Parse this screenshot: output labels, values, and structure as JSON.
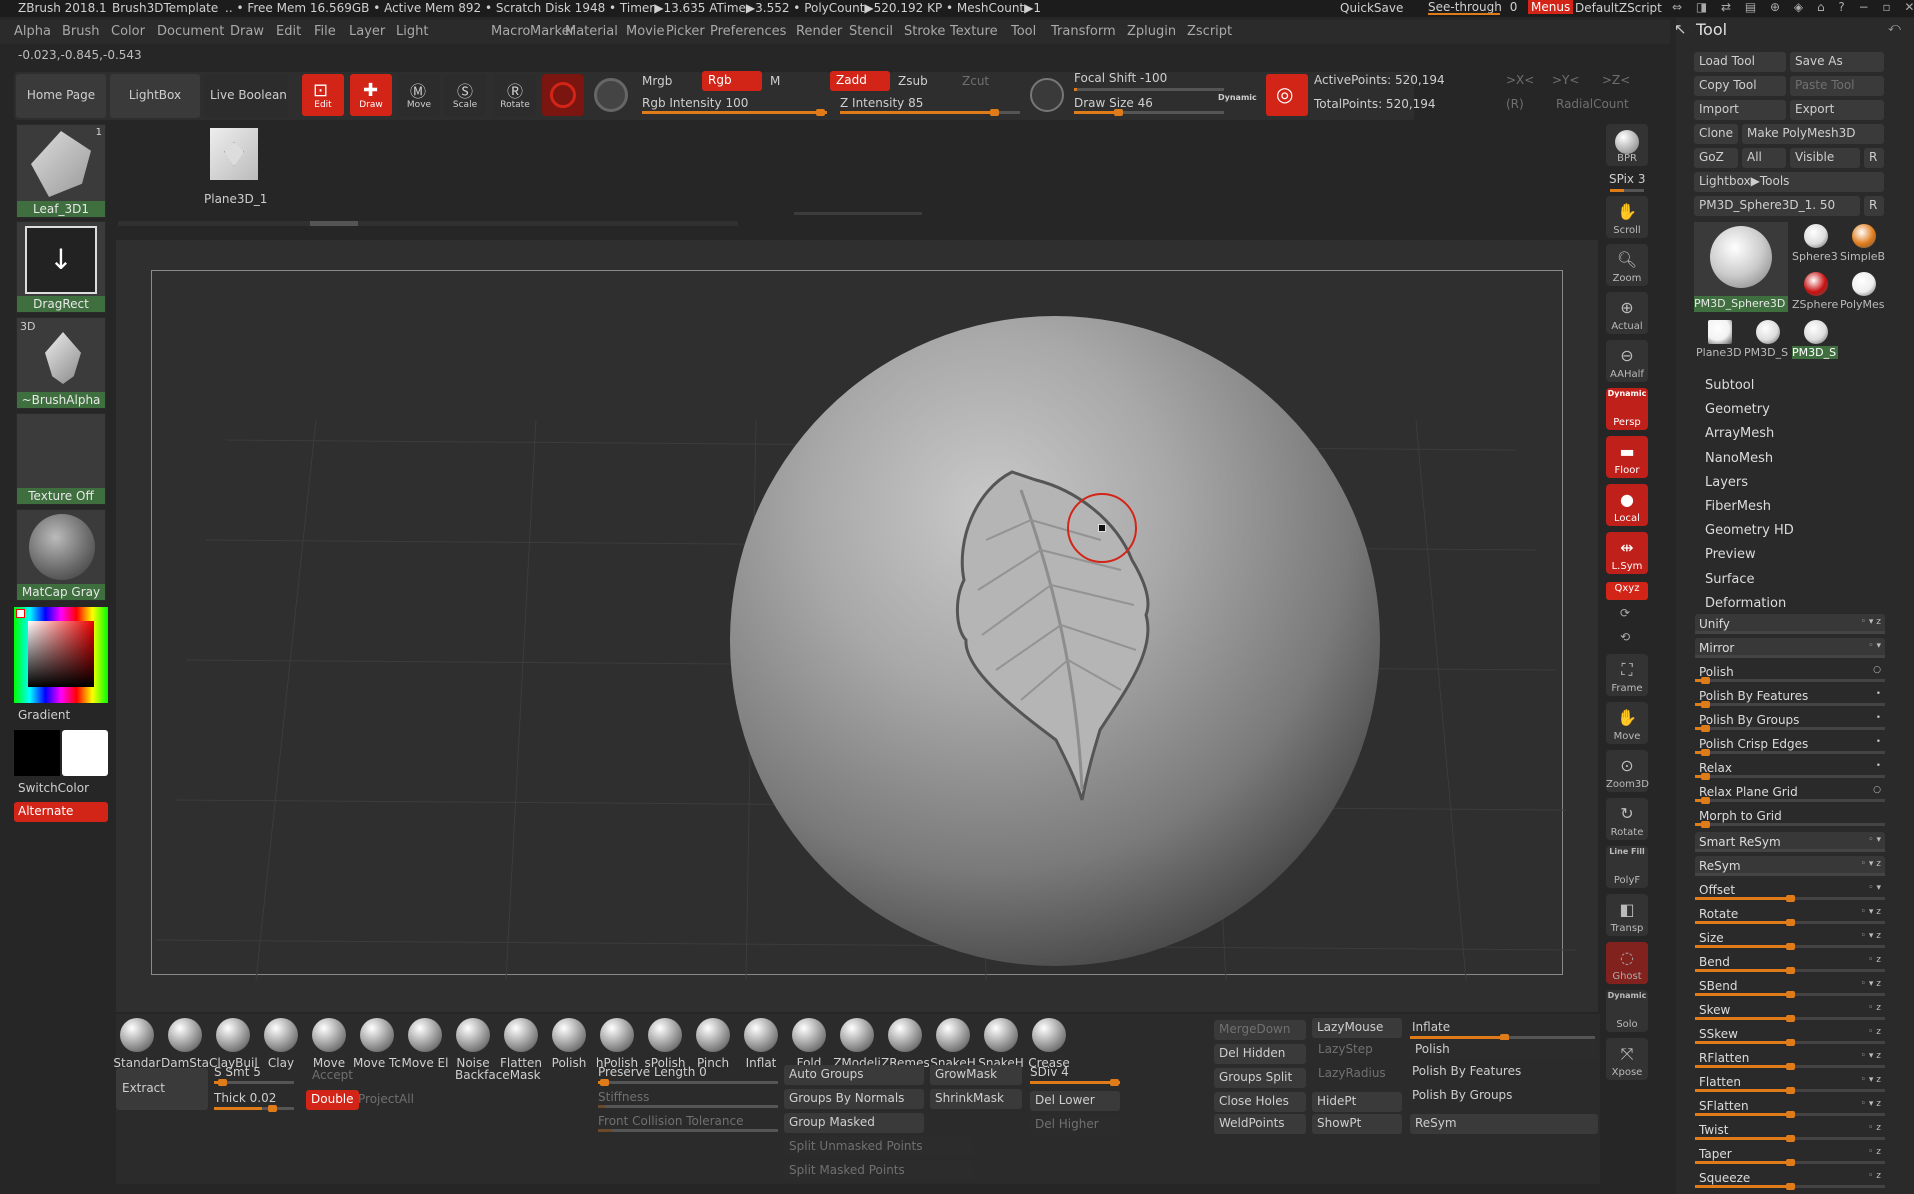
{
  "titlebar": {
    "app": "ZBrush 2018.1",
    "document": "Brush3DTemplate",
    "stats": ".. • Free Mem 16.569GB • Active Mem 892 • Scratch Disk 1948 • Timer▶13.635 ATime▶3.552 • PolyCount▶520.192 KP • MeshCount▶1",
    "quicksave": "QuickSave",
    "seethrough": "See-through",
    "seethrough_value": "0",
    "menus": "Menus",
    "script": "DefaultZScript"
  },
  "menubar": [
    "Alpha",
    "Brush",
    "Color",
    "Document",
    "Draw",
    "Edit",
    "File",
    "Layer",
    "Light",
    "Macro",
    "Marker",
    "Material",
    "Movie",
    "Picker",
    "Preferences",
    "Render",
    "Stencil",
    "Stroke",
    "Texture",
    "Tool",
    "Transform",
    "Zplugin",
    "Zscript"
  ],
  "coords": "-0.023,-0.845,-0.543",
  "toolbar": {
    "home": "Home Page",
    "lightbox": "LightBox",
    "liveboolean": "Live Boolean",
    "edit": "Edit",
    "draw": "Draw",
    "move": "Move",
    "scale": "Scale",
    "rotate": "Rotate",
    "mrgb": "Mrgb",
    "rgb": "Rgb",
    "m": "M",
    "rgb_intensity": "Rgb Intensity",
    "rgb_intensity_value": "100",
    "zadd": "Zadd",
    "zsub": "Zsub",
    "zcut": "Zcut",
    "z_intensity": "Z Intensity",
    "z_intensity_value": "85",
    "focal_shift": "Focal Shift",
    "focal_shift_value": "-100",
    "draw_size": "Draw Size",
    "draw_size_value": "46",
    "dynamic": "Dynamic",
    "active_points": "ActivePoints: 520,194",
    "total_points": "TotalPoints: 520,194",
    "x_axis": ">X<",
    "y_axis": ">Y<",
    "z_axis": ">Z<",
    "r_label": "(R)",
    "radial_count": "RadialCount"
  },
  "left": {
    "brush_name": "Leaf_3D1",
    "brush_count": "1",
    "stroke": "DragRect",
    "alpha_tag": "3D",
    "alpha": "~BrushAlpha",
    "texture": "Texture Off",
    "material": "MatCap Gray",
    "gradient": "Gradient",
    "switch_color": "SwitchColor",
    "alternate": "Alternate"
  },
  "tray": {
    "item": "Plane3D_1"
  },
  "viewbuttons": [
    {
      "label": "BPR",
      "name": "bpr-button"
    },
    {
      "label": "Scroll",
      "name": "scroll-button"
    },
    {
      "label": "Zoom",
      "name": "zoom-button"
    },
    {
      "label": "Actual",
      "name": "actual-button"
    },
    {
      "label": "AAHalf",
      "name": "aahalf-button"
    },
    {
      "label": "Persp",
      "name": "persp-button"
    },
    {
      "label": "Floor",
      "name": "floor-button"
    },
    {
      "label": "Local",
      "name": "local-button"
    },
    {
      "label": "L.Sym",
      "name": "lsym-button"
    },
    {
      "label": "Frame",
      "name": "frame-button"
    },
    {
      "label": "Move",
      "name": "view-move-button"
    },
    {
      "label": "Zoom3D",
      "name": "zoom3d-button"
    },
    {
      "label": "Rotate",
      "name": "view-rotate-button"
    },
    {
      "label": "PolyF",
      "name": "polyf-button"
    },
    {
      "label": "Transp",
      "name": "transp-button"
    },
    {
      "label": "Ghost",
      "name": "ghost-button"
    },
    {
      "label": "Solo",
      "name": "solo-button"
    },
    {
      "label": "Xpose",
      "name": "xpose-button"
    }
  ],
  "spix": "SPix 3",
  "dynamic_label": "Dynamic",
  "xyz_label": "Qxyz",
  "line_fill": "Line Fill",
  "brushes": [
    "Standar",
    "DamSta",
    "ClayBuil",
    "Clay",
    "Move",
    "Move Tc",
    "Move El",
    "Noise",
    "Flatten",
    "Polish",
    "hPolish",
    "sPolish",
    "Pinch",
    "Inflat",
    "Fold",
    "ZModeli",
    "ZRemes",
    "SnakeH",
    "SnakeH",
    "Crease"
  ],
  "bottom": {
    "extract": "Extract",
    "ssmt": "S Smt 5",
    "thick": "Thick 0.02",
    "accept": "Accept",
    "double": "Double",
    "projectall": "ProjectAll",
    "backfacemask": "BackfaceMask",
    "preserve_length": "Preserve Length 0",
    "stiffness": "Stiffness",
    "front_collision": "Front Collision Tolerance",
    "auto_groups": "Auto Groups",
    "groups_by_normals": "Groups By Normals",
    "group_masked": "Group Masked",
    "split_unmasked": "Split Unmasked Points",
    "split_masked": "Split Masked Points",
    "growmask": "GrowMask",
    "shrinkmask": "ShrinkMask",
    "sdiv": "SDiv 4",
    "del_lower": "Del Lower",
    "del_higher": "Del Higher",
    "mergedown": "MergeDown",
    "del_hidden": "Del Hidden",
    "groups_split": "Groups Split",
    "close_holes": "Close Holes",
    "weldpoints": "WeldPoints",
    "lazymouse": "LazyMouse",
    "lazystep": "LazyStep",
    "lazyradius": "LazyRadius",
    "hidept": "HidePt",
    "showpt": "ShowPt",
    "inflate": "Inflate",
    "polish": "Polish",
    "polish_by_features": "Polish By Features",
    "polish_by_groups": "Polish By Groups",
    "resym": "ReSym"
  },
  "right": {
    "title": "Tool",
    "load_tool": "Load Tool",
    "save_as": "Save As",
    "copy_tool": "Copy Tool",
    "paste_tool": "Paste Tool",
    "import": "Import",
    "export": "Export",
    "clone": "Clone",
    "make_polymesh": "Make PolyMesh3D",
    "goz": "GoZ",
    "all": "All",
    "visible": "Visible",
    "r": "R",
    "lightbox_tools": "Lightbox▶Tools",
    "current_tool": "PM3D_Sphere3D_1. 50",
    "thumb_main": "PM3D_Sphere3D",
    "thumbs": [
      "Sphere3",
      "SimpleB",
      "ZSphere",
      "PolyMes",
      "Plane3D",
      "PM3D_S",
      "PM3D_S"
    ],
    "sections": [
      "Subtool",
      "Geometry",
      "ArrayMesh",
      "NanoMesh",
      "Layers",
      "FiberMesh",
      "Geometry HD",
      "Preview",
      "Surface",
      "Deformation"
    ],
    "deformation": [
      {
        "label": "Unify",
        "fill": 0,
        "mark": "◦ ▾ z"
      },
      {
        "label": "Mirror",
        "fill": 0,
        "mark": "◦ ▾"
      },
      {
        "label": "Polish",
        "fill": 0.05,
        "mark": "○"
      },
      {
        "label": "Polish By Features",
        "fill": 0.05,
        "mark": "•"
      },
      {
        "label": "Polish By Groups",
        "fill": 0.05,
        "mark": "•"
      },
      {
        "label": "Polish Crisp Edges",
        "fill": 0.05,
        "mark": "•"
      },
      {
        "label": "Relax",
        "fill": 0.05,
        "mark": "•"
      },
      {
        "label": "Relax Plane Grid",
        "fill": 0.05,
        "mark": "○"
      },
      {
        "label": "Morph to Grid",
        "fill": 0.05,
        "mark": ""
      },
      {
        "label": "Smart ReSym",
        "fill": 0,
        "mark": "◦ ▾"
      },
      {
        "label": "ReSym",
        "fill": 0,
        "mark": "◦ ▾ z"
      },
      {
        "label": "Offset",
        "fill": 0.5,
        "mark": "◦ ▾"
      },
      {
        "label": "Rotate",
        "fill": 0.5,
        "mark": "◦ ▾ z"
      },
      {
        "label": "Size",
        "fill": 0.5,
        "mark": "◦ ▾ z"
      },
      {
        "label": "Bend",
        "fill": 0.5,
        "mark": "◦ z"
      },
      {
        "label": "SBend",
        "fill": 0.5,
        "mark": "◦ ▾ z"
      },
      {
        "label": "Skew",
        "fill": 0.5,
        "mark": "◦ z"
      },
      {
        "label": "SSkew",
        "fill": 0.5,
        "mark": "◦ z"
      },
      {
        "label": "RFlatten",
        "fill": 0.5,
        "mark": "◦ ▾ z"
      },
      {
        "label": "Flatten",
        "fill": 0.5,
        "mark": "◦ ▾ z"
      },
      {
        "label": "SFlatten",
        "fill": 0.5,
        "mark": "◦ ▾ z"
      },
      {
        "label": "Twist",
        "fill": 0.5,
        "mark": "◦ z"
      },
      {
        "label": "Taper",
        "fill": 0.5,
        "mark": "◦ z"
      },
      {
        "label": "Squeeze",
        "fill": 0.5,
        "mark": "◦ z"
      }
    ]
  },
  "colors": {
    "accent": "#e07b1a",
    "active": "#d32418",
    "selected": "#3f6f3f"
  }
}
